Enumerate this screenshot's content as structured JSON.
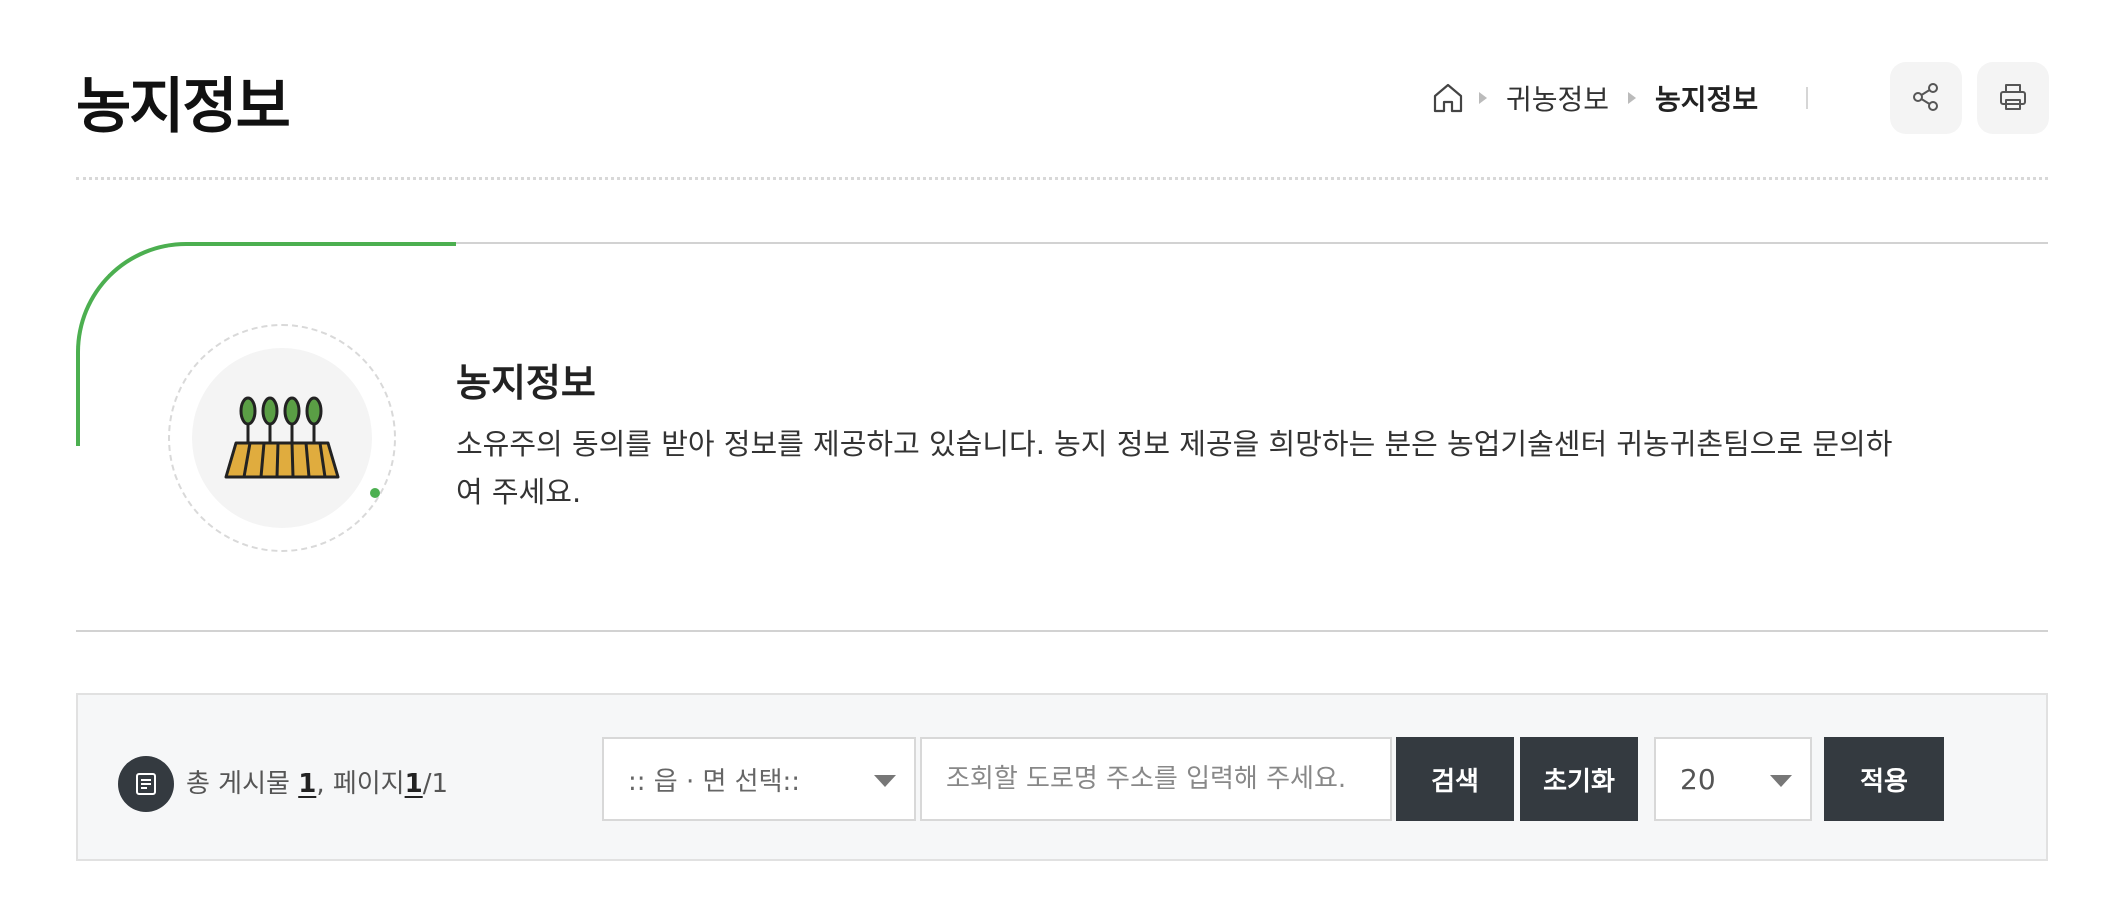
{
  "header": {
    "title": "농지정보",
    "breadcrumb": {
      "items": [
        "귀농정보",
        "농지정보"
      ]
    },
    "utilities": {
      "share_icon": "share-icon",
      "print_icon": "print-icon"
    }
  },
  "intro": {
    "heading": "농지정보",
    "description": "소유주의 동의를 받아 정보를 제공하고 있습니다. 농지 정보 제공을 희망하는 분은 농업기술센터 귀농귀촌팀으로 문의하여 주세요.",
    "icon": "farmland-icon",
    "accent_color": "#4caf50"
  },
  "search": {
    "total_label": "총 게시물",
    "total_count": "1",
    "page_label": "페이지",
    "page_current": "1",
    "page_total": "/1",
    "region_select": ":: 읍 · 면 선택::",
    "address_placeholder": "조회할 도로명 주소를 입력해 주세요.",
    "search_button": "검색",
    "reset_button": "초기화",
    "per_page": "20",
    "apply_button": "적용",
    "button_color": "#343a40"
  }
}
